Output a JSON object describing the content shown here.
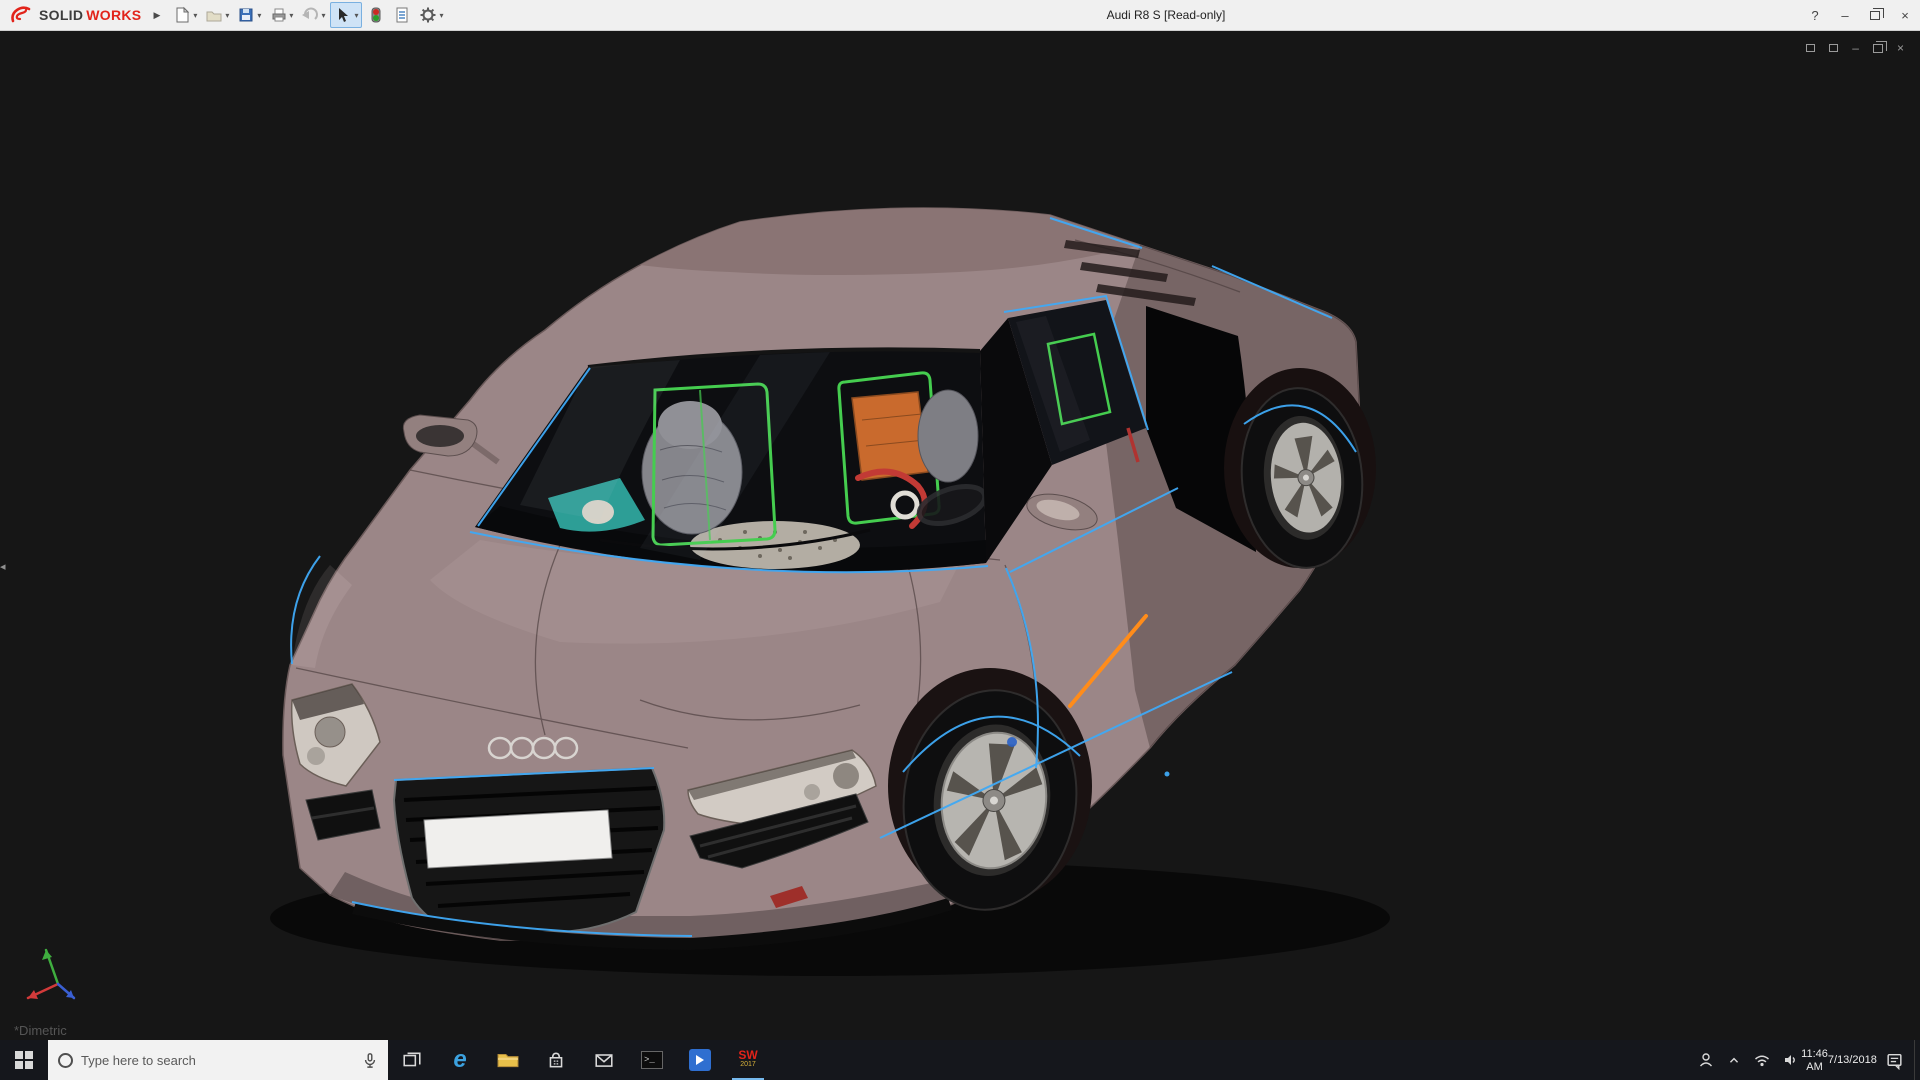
{
  "colors": {
    "brand-red": "#e2231a",
    "titlebar-bg": "#f0f0f0",
    "viewport-bg": "#161616",
    "taskbar-bg": "#15171c",
    "accent-blue": "#3fa9f5",
    "accent-orange": "#ff8c1a",
    "accent-green": "#45cd4f",
    "body-mauve": "#9b8687",
    "body-mauve-dark": "#7e6a6a",
    "body-mauve-light": "#a8928e"
  },
  "titlebar": {
    "brand": {
      "solid": "SOLID",
      "works": "WORKS"
    },
    "title": "Audi R8 S [Read-only]"
  },
  "icons": {
    "help": "?",
    "minimize": "–",
    "close": "×",
    "menu_expand": "▶",
    "dropdown": "▾",
    "flyout": "◂",
    "edge": "e",
    "command_prompt": "&gt;_"
  },
  "toolbar": {
    "items": [
      {
        "name": "new-document",
        "dropdown": true
      },
      {
        "name": "open",
        "dropdown": true
      },
      {
        "name": "save",
        "dropdown": true
      },
      {
        "name": "print",
        "dropdown": true
      },
      {
        "name": "undo",
        "dropdown": true
      },
      {
        "name": "select",
        "dropdown": true,
        "active": true
      },
      {
        "name": "rebuild",
        "dropdown": false
      },
      {
        "name": "file-properties",
        "dropdown": false
      },
      {
        "name": "options",
        "dropdown": true
      }
    ]
  },
  "document_window": {
    "controls": [
      "new-window",
      "window-list",
      "minimize",
      "restore",
      "close"
    ]
  },
  "viewport": {
    "orientation_label": "*Dimetric"
  },
  "taskbar": {
    "search_placeholder": "Type here to search",
    "solidworks_icon": {
      "text": "SW",
      "year": "2017"
    },
    "clock": {
      "time": "11:46 AM",
      "date": "7/13/2018"
    }
  }
}
